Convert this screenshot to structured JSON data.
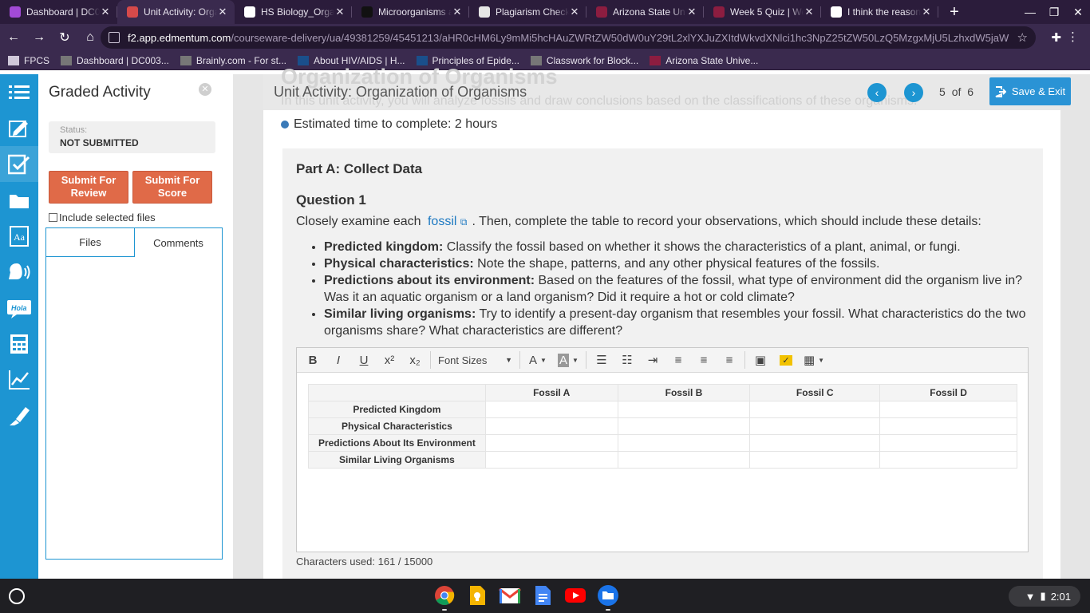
{
  "browser": {
    "tabs": [
      {
        "title": "Dashboard | DC003",
        "icon": "course-icon",
        "color": "#a24ad6"
      },
      {
        "title": "Unit Activity: Orga",
        "icon": "edmentum-icon",
        "color": "#d64a4a",
        "active": true
      },
      {
        "title": "HS Biology_Organ",
        "icon": "globe-icon",
        "color": "#ffffff"
      },
      {
        "title": "Microorganisms a",
        "icon": "brainly-icon",
        "color": "#111111"
      },
      {
        "title": "Plagiarism Checke",
        "icon": "sst-icon",
        "color": "#e6e6e6"
      },
      {
        "title": "Arizona State Univ",
        "icon": "asu-icon",
        "color": "#8c1d40"
      },
      {
        "title": "Week 5 Quiz | Wee",
        "icon": "asu-icon",
        "color": "#8c1d40"
      },
      {
        "title": "I think the reason",
        "icon": "google-icon",
        "color": "#ffffff"
      }
    ],
    "new_tab": "+",
    "url_host": "f2.app.edmentum.com",
    "url_path": "/courseware-delivery/ua/49381259/45451213/aHR0cHM6Ly9mMi5hcHAuZWRtZW50dW0uY29tL2xlYXJuZXItdWkvdXNlci1hc3NpZ25tZW50LzQ5MzgxMjU5LzhxdW5jaWBHb...",
    "bookmarks": [
      {
        "label": "FPCS",
        "icon": "folder-icon"
      },
      {
        "label": "Dashboard | DC003...",
        "icon": "course-icon"
      },
      {
        "label": "Brainly.com - For st...",
        "icon": "brainly-icon"
      },
      {
        "label": "About HIV/AIDS | H...",
        "icon": "cdc-icon"
      },
      {
        "label": "Principles of Epide...",
        "icon": "cdc-icon"
      },
      {
        "label": "Classwork for Block...",
        "icon": "classroom-icon"
      },
      {
        "label": "Arizona State Unive...",
        "icon": "asu-icon"
      }
    ]
  },
  "panel": {
    "title": "Graded Activity",
    "status_label": "Status:",
    "status_value": "NOT SUBMITTED",
    "submit_review": "Submit For Review",
    "submit_score": "Submit For Score",
    "include_files": "Include selected files",
    "tab_files": "Files",
    "tab_comments": "Comments"
  },
  "header": {
    "ghost_title": "Organization of Organisms",
    "ghost_subtitle": "In this unit activity, you will analyze fossils and draw conclusions based on the classifications of these organisms.",
    "title": "Unit Activity: Organization of Organisms",
    "page_current": "5",
    "page_of": "of",
    "page_total": "6",
    "save_exit": "Save & Exit"
  },
  "content": {
    "estimated": "Estimated time to complete: 2 hours",
    "part": "Part A: Collect Data",
    "question": "Question 1",
    "intro_before": "Closely examine each",
    "intro_link": "fossil",
    "intro_after": ". Then, complete the table to record your observations, which should include these details:",
    "bullets": [
      {
        "bold": "Predicted kingdom:",
        "text": " Classify the fossil based on whether it shows the characteristics of a plant, animal, or fungi."
      },
      {
        "bold": "Physical characteristics:",
        "text": " Note the shape, patterns, and any other physical features of the fossils."
      },
      {
        "bold": "Predictions about its environment:",
        "text": " Based on the features of the fossil, what type of environment did the organism live in? Was it an aquatic organism or a land organism? Did it require a hot or cold climate?"
      },
      {
        "bold": "Similar living organisms:",
        "text": " Try to identify a present-day organism that resembles your fossil. What characteristics do the two organisms share? What characteristics are different?"
      }
    ],
    "editor": {
      "font_sizes": "Font Sizes",
      "columns": [
        "",
        "Fossil A",
        "Fossil B",
        "Fossil C",
        "Fossil D"
      ],
      "rows": [
        "Predicted Kingdom",
        "Physical Characteristics",
        "Predictions About Its Environment",
        "Similar Living Organisms"
      ]
    },
    "characters_used": "Characters used: 161 / 15000"
  },
  "taskbar": {
    "apps": [
      "chrome-icon",
      "keep-icon",
      "gmail-icon",
      "docs-icon",
      "youtube-icon",
      "files-icon"
    ],
    "time": "2:01"
  }
}
